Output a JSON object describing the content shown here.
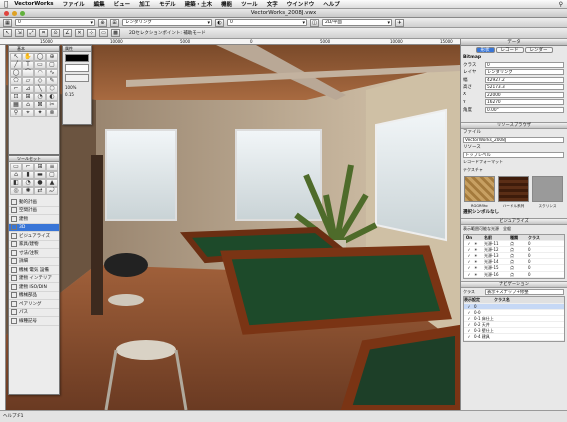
{
  "menubar": {
    "app": "VectorWorks",
    "items": [
      "ファイル",
      "編集",
      "ビュー",
      "加工",
      "モデル",
      "建築・土木",
      "機能",
      "ツール",
      "文字",
      "ウインドウ",
      "ヘルプ"
    ]
  },
  "window": {
    "title": "VectorWorks_2008J.vwx"
  },
  "toolbar1": {
    "class_dropdown": "0",
    "render_dropdown": "レンダリング",
    "view_dropdown": "2D/平面",
    "layer_dropdown": "0"
  },
  "toolbar2": {
    "mode_label": "2Dセレクションポイント: 補助モード",
    "zoom": "100"
  },
  "ruler": {
    "ticks": [
      "15000",
      "10000",
      "5000",
      "0",
      "5000",
      "10000",
      "15000"
    ]
  },
  "statusbar": {
    "text": "ヘルプ:F1"
  },
  "tool_palette": {
    "title": "基本",
    "tools": [
      "↖",
      "✋",
      "◯",
      "⊕",
      "╱",
      "T",
      "▭",
      "▢",
      "◯",
      "⌒",
      "◠",
      "∿",
      "⬠",
      "▱",
      "◇",
      "✎",
      "⌐",
      "⊿",
      "╲",
      "⬡",
      "⊡",
      "⊞",
      "◔",
      "◐",
      "▦",
      "⌂",
      "⊠",
      "✂",
      "⚲",
      "⌖",
      "✦",
      "⊗"
    ]
  },
  "attr_palette": {
    "title": "属性",
    "fill_label": "",
    "pen_label": "",
    "pen_weight": "100%",
    "opacity": "0.15"
  },
  "tool_sets": {
    "title": "ツールセット",
    "items": [
      "動的計画",
      "空間計画",
      "建物",
      "3D",
      "ビジュアライズ",
      "家具/建物",
      "寸法/注釈",
      "詳細",
      "機械 電気 設備",
      "建物 インテリア",
      "建物 ISO/DIN",
      "機械部品",
      "ペアリング",
      "パス",
      "線種記号"
    ],
    "selected": "3D"
  },
  "right_panel": {
    "title": "データ",
    "tabs": [
      "形状",
      "レコード",
      "レンダー"
    ],
    "object_type": "Bitmap",
    "props": [
      {
        "k": "クラス",
        "v": "0"
      },
      {
        "k": "レイヤ",
        "v": "レンダリング"
      },
      {
        "k": "幅",
        "v": "42927.2"
      },
      {
        "k": "高さ",
        "v": "52173.3"
      },
      {
        "k": "X",
        "v": "22000"
      },
      {
        "k": "Y",
        "v": "16270"
      },
      {
        "k": "角度",
        "v": "0.00°"
      }
    ],
    "resource_title": "リソースブラウザ",
    "file_label": "ファイル",
    "file_value": "VectorWorks_2008J",
    "resource_label": "リソース",
    "resource_value": "トップレベル",
    "resource_format": "レコードフォーマット",
    "texture_label": "テクスチャ",
    "thumbs": [
      "RGGRflhc",
      "ハードル系列",
      "スクリンス"
    ],
    "symbol_label": "選択シンボルなし",
    "visualize_title": "ビジュアライズ",
    "visualize_opt1": "表示範囲可能な光源",
    "visualize_opt2": "全般",
    "vis_headers": [
      "On",
      "名前",
      "種類",
      "クラス"
    ],
    "vis_rows": [
      {
        "on": "✓",
        "name": "光源-11",
        "kind": "点",
        "cls": "0"
      },
      {
        "on": "✓",
        "name": "光源-12",
        "kind": "点",
        "cls": "0"
      },
      {
        "on": "✓",
        "name": "光源-13",
        "kind": "点",
        "cls": "0"
      },
      {
        "on": "✓",
        "name": "光源-14",
        "kind": "点",
        "cls": "0"
      },
      {
        "on": "✓",
        "name": "光源-15",
        "kind": "点",
        "cls": "0"
      },
      {
        "on": "✓",
        "name": "光源-16",
        "kind": "点",
        "cls": "0"
      }
    ],
    "navigation_title": "ナビゲーション",
    "nav_label": "クラス",
    "nav_filter": "表示+スナップ+修整",
    "nav_headers": [
      "表示設定",
      "クラス名"
    ],
    "nav_rows": [
      "0",
      "0-0",
      "0-1 床仕上",
      "0-2 天井",
      "0-3 壁仕上",
      "0-4 建具"
    ]
  }
}
